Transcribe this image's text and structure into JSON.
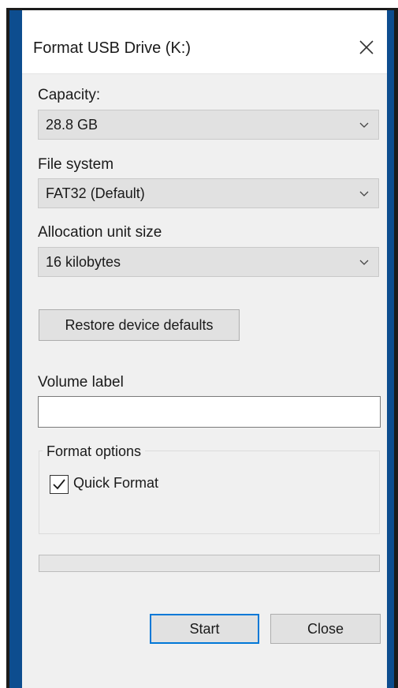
{
  "window": {
    "title": "Format USB Drive (K:)",
    "close_icon": "close-icon"
  },
  "capacity": {
    "label": "Capacity:",
    "value": "28.8 GB"
  },
  "file_system": {
    "label": "File system",
    "value": "FAT32 (Default)"
  },
  "allocation": {
    "label": "Allocation unit size",
    "value": "16 kilobytes"
  },
  "restore_button": {
    "label": "Restore device defaults"
  },
  "volume": {
    "label": "Volume label",
    "value": ""
  },
  "format_options": {
    "title": "Format options",
    "quick_format": {
      "label": "Quick Format",
      "checked": true
    }
  },
  "progress": {
    "fraction": 0
  },
  "footer": {
    "start_label": "Start",
    "close_label": "Close"
  },
  "colors": {
    "accent_frame": "#0d4d8f",
    "dialog_bg": "#f0f0f0",
    "focus_border": "#0078d7"
  }
}
